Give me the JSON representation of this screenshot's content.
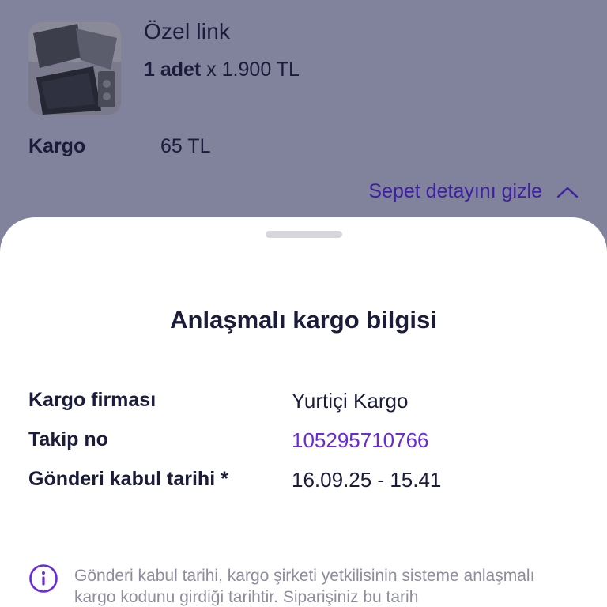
{
  "product": {
    "image_icon": "product-photo-icon",
    "name": "Özel link",
    "quantity": "1 adet",
    "price": " x 1.900 TL"
  },
  "shipping": {
    "label": "Kargo",
    "value": "65 TL"
  },
  "basket_toggle": {
    "label": "Sepet detayını gizle",
    "icon": "chevron-up-icon"
  },
  "sheet": {
    "title": "Anlaşmalı kargo bilgisi",
    "rows": [
      {
        "label": "Kargo firması",
        "value": "Yurtiçi Kargo"
      },
      {
        "label": "Takip no",
        "value": "105295710766"
      },
      {
        "label": "Gönderi kabul tarihi *",
        "value": "16.09.25 - 15.41"
      }
    ],
    "note": {
      "icon": "info-icon",
      "text": "Gönderi kabul tarihi, kargo şirketi yetkilisinin sisteme anlaşmalı kargo kodunu girdiği tarihtir. Siparişiniz bu tarih"
    }
  },
  "colors": {
    "overlay_background": "#80839b",
    "primary_text": "#1b1b3a",
    "accent": "#6a2bd8",
    "link_dimmed": "#3e1fa0",
    "muted_text": "#8d8d9c",
    "sheet_background": "#ffffff"
  }
}
